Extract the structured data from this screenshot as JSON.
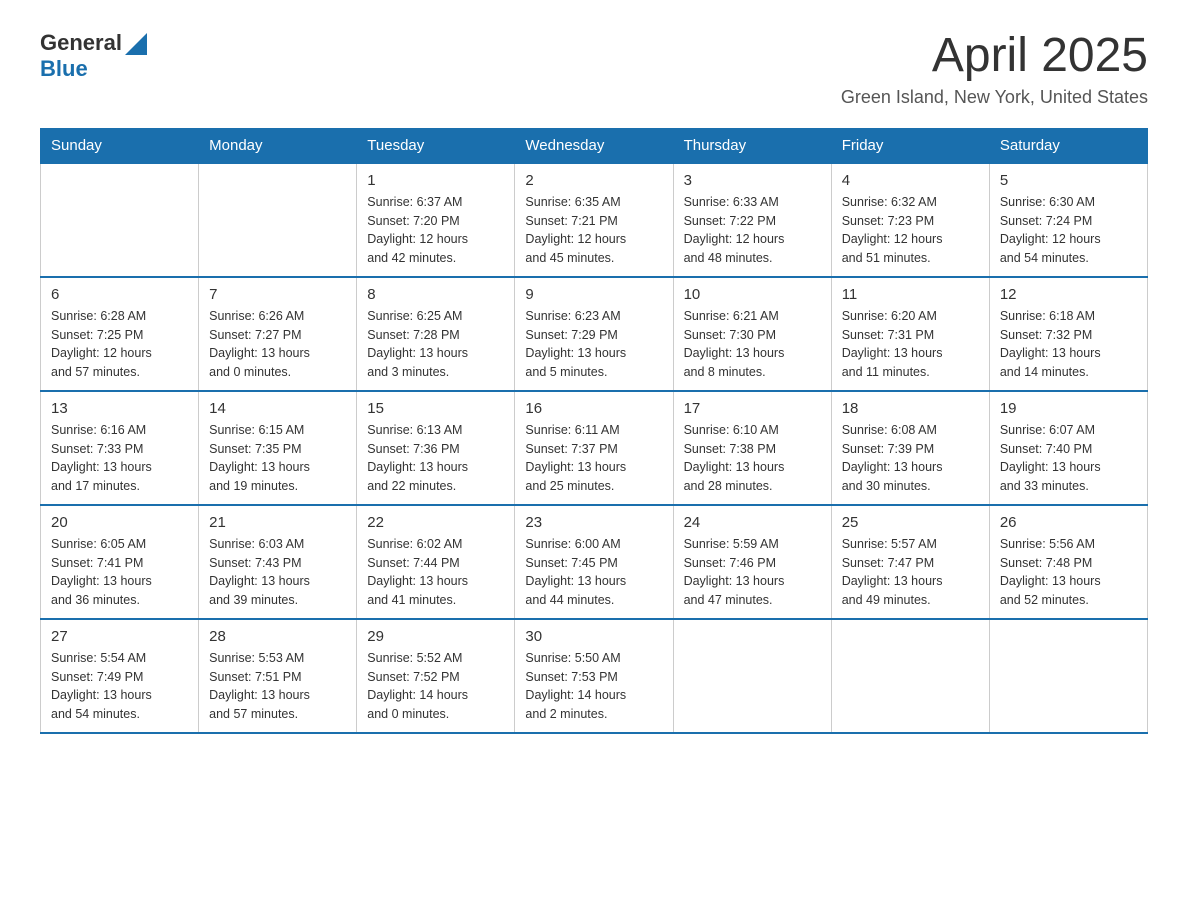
{
  "header": {
    "logo_general": "General",
    "logo_blue": "Blue",
    "title": "April 2025",
    "subtitle": "Green Island, New York, United States"
  },
  "weekdays": [
    "Sunday",
    "Monday",
    "Tuesday",
    "Wednesday",
    "Thursday",
    "Friday",
    "Saturday"
  ],
  "weeks": [
    [
      {
        "day": "",
        "info": ""
      },
      {
        "day": "",
        "info": ""
      },
      {
        "day": "1",
        "info": "Sunrise: 6:37 AM\nSunset: 7:20 PM\nDaylight: 12 hours\nand 42 minutes."
      },
      {
        "day": "2",
        "info": "Sunrise: 6:35 AM\nSunset: 7:21 PM\nDaylight: 12 hours\nand 45 minutes."
      },
      {
        "day": "3",
        "info": "Sunrise: 6:33 AM\nSunset: 7:22 PM\nDaylight: 12 hours\nand 48 minutes."
      },
      {
        "day": "4",
        "info": "Sunrise: 6:32 AM\nSunset: 7:23 PM\nDaylight: 12 hours\nand 51 minutes."
      },
      {
        "day": "5",
        "info": "Sunrise: 6:30 AM\nSunset: 7:24 PM\nDaylight: 12 hours\nand 54 minutes."
      }
    ],
    [
      {
        "day": "6",
        "info": "Sunrise: 6:28 AM\nSunset: 7:25 PM\nDaylight: 12 hours\nand 57 minutes."
      },
      {
        "day": "7",
        "info": "Sunrise: 6:26 AM\nSunset: 7:27 PM\nDaylight: 13 hours\nand 0 minutes."
      },
      {
        "day": "8",
        "info": "Sunrise: 6:25 AM\nSunset: 7:28 PM\nDaylight: 13 hours\nand 3 minutes."
      },
      {
        "day": "9",
        "info": "Sunrise: 6:23 AM\nSunset: 7:29 PM\nDaylight: 13 hours\nand 5 minutes."
      },
      {
        "day": "10",
        "info": "Sunrise: 6:21 AM\nSunset: 7:30 PM\nDaylight: 13 hours\nand 8 minutes."
      },
      {
        "day": "11",
        "info": "Sunrise: 6:20 AM\nSunset: 7:31 PM\nDaylight: 13 hours\nand 11 minutes."
      },
      {
        "day": "12",
        "info": "Sunrise: 6:18 AM\nSunset: 7:32 PM\nDaylight: 13 hours\nand 14 minutes."
      }
    ],
    [
      {
        "day": "13",
        "info": "Sunrise: 6:16 AM\nSunset: 7:33 PM\nDaylight: 13 hours\nand 17 minutes."
      },
      {
        "day": "14",
        "info": "Sunrise: 6:15 AM\nSunset: 7:35 PM\nDaylight: 13 hours\nand 19 minutes."
      },
      {
        "day": "15",
        "info": "Sunrise: 6:13 AM\nSunset: 7:36 PM\nDaylight: 13 hours\nand 22 minutes."
      },
      {
        "day": "16",
        "info": "Sunrise: 6:11 AM\nSunset: 7:37 PM\nDaylight: 13 hours\nand 25 minutes."
      },
      {
        "day": "17",
        "info": "Sunrise: 6:10 AM\nSunset: 7:38 PM\nDaylight: 13 hours\nand 28 minutes."
      },
      {
        "day": "18",
        "info": "Sunrise: 6:08 AM\nSunset: 7:39 PM\nDaylight: 13 hours\nand 30 minutes."
      },
      {
        "day": "19",
        "info": "Sunrise: 6:07 AM\nSunset: 7:40 PM\nDaylight: 13 hours\nand 33 minutes."
      }
    ],
    [
      {
        "day": "20",
        "info": "Sunrise: 6:05 AM\nSunset: 7:41 PM\nDaylight: 13 hours\nand 36 minutes."
      },
      {
        "day": "21",
        "info": "Sunrise: 6:03 AM\nSunset: 7:43 PM\nDaylight: 13 hours\nand 39 minutes."
      },
      {
        "day": "22",
        "info": "Sunrise: 6:02 AM\nSunset: 7:44 PM\nDaylight: 13 hours\nand 41 minutes."
      },
      {
        "day": "23",
        "info": "Sunrise: 6:00 AM\nSunset: 7:45 PM\nDaylight: 13 hours\nand 44 minutes."
      },
      {
        "day": "24",
        "info": "Sunrise: 5:59 AM\nSunset: 7:46 PM\nDaylight: 13 hours\nand 47 minutes."
      },
      {
        "day": "25",
        "info": "Sunrise: 5:57 AM\nSunset: 7:47 PM\nDaylight: 13 hours\nand 49 minutes."
      },
      {
        "day": "26",
        "info": "Sunrise: 5:56 AM\nSunset: 7:48 PM\nDaylight: 13 hours\nand 52 minutes."
      }
    ],
    [
      {
        "day": "27",
        "info": "Sunrise: 5:54 AM\nSunset: 7:49 PM\nDaylight: 13 hours\nand 54 minutes."
      },
      {
        "day": "28",
        "info": "Sunrise: 5:53 AM\nSunset: 7:51 PM\nDaylight: 13 hours\nand 57 minutes."
      },
      {
        "day": "29",
        "info": "Sunrise: 5:52 AM\nSunset: 7:52 PM\nDaylight: 14 hours\nand 0 minutes."
      },
      {
        "day": "30",
        "info": "Sunrise: 5:50 AM\nSunset: 7:53 PM\nDaylight: 14 hours\nand 2 minutes."
      },
      {
        "day": "",
        "info": ""
      },
      {
        "day": "",
        "info": ""
      },
      {
        "day": "",
        "info": ""
      }
    ]
  ]
}
